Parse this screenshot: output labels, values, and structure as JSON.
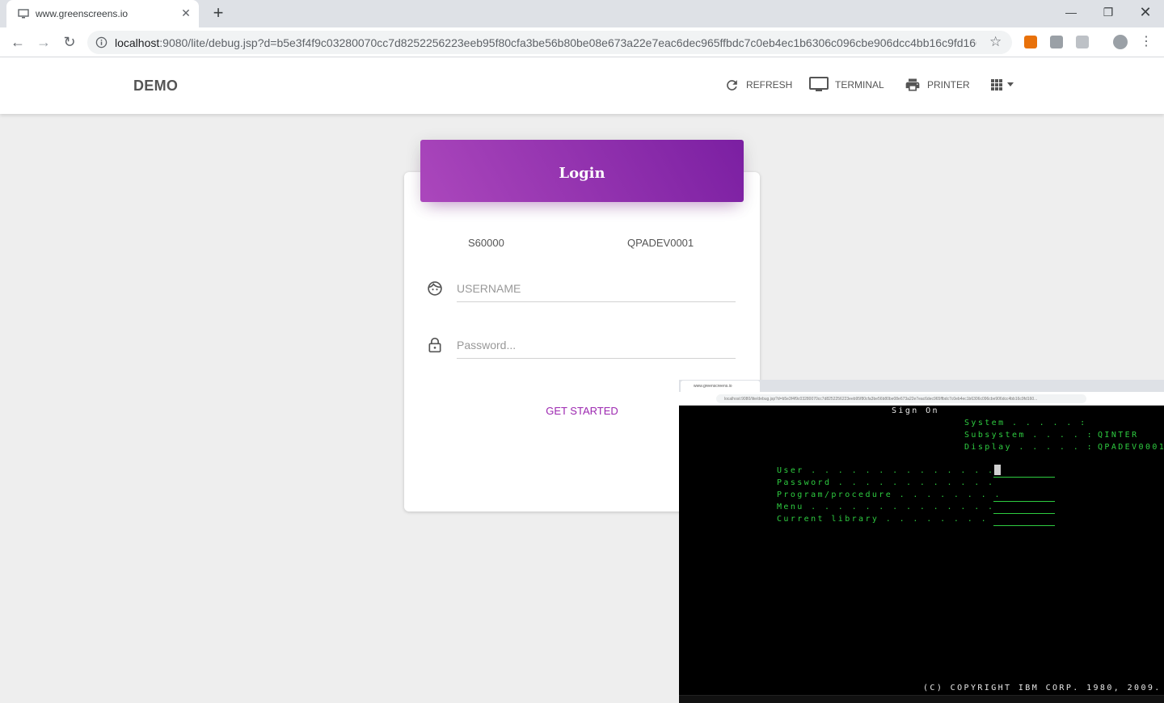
{
  "browser": {
    "tab_title": "www.greenscreens.io",
    "url_host": "localhost",
    "url_rest": ":9080/lite/debug.jsp?d=b5e3f4f9c03280070cc7d8252256223eeb95f80cfa3be56b80be08e673a22e7eac6dec965ffbdc7c0eb4ec1b6306c096cbe906dcc4bb16c9fd160...",
    "new_tab_label": "+"
  },
  "app": {
    "brand": "DEMO",
    "nav": {
      "refresh": "REFRESH",
      "terminal": "TERMINAL",
      "printer": "PRINTER"
    }
  },
  "login": {
    "title": "Login",
    "system_id": "S60000",
    "device_name": "QPADEV0001",
    "username_placeholder": "USERNAME",
    "password_placeholder": "Password...",
    "submit_label": "GET STARTED"
  },
  "terminal_preview": {
    "tab_title": "www.greenscreens.io",
    "url": "localhost:9080/lite/debug.jsp?d=b5e3f4f9c03280070cc7d8252256223eeb95f80cfa3be56b80be08e673a22e7eac6dec965ffbdc7c0eb4ec1b6306c096cbe906dcc4bb16c9fd160...",
    "heading": "Sign On",
    "system_label": "System . . . . . :",
    "system_value": "",
    "subsystem_label": "Subsystem . . . . :",
    "subsystem_value": "QINTER",
    "display_label": "Display . . . . . :",
    "display_value": "QPADEV0001",
    "user_label": "User . . . . . . . . . . . . . .",
    "password_label": "Password . . . . . . . . . . . .",
    "program_label": "Program/procedure . . . . . . . .",
    "menu_label": "Menu . . . . . . . . . . . . . .",
    "library_label": "Current library . . . . . . . .",
    "copyright": "(C) COPYRIGHT IBM CORP. 1980, 2009."
  },
  "colors": {
    "accent": "#9c27b0",
    "header_gradient_start": "#ab47bc",
    "header_gradient_end": "#7b1fa2",
    "terminal_green": "#2ecc40",
    "page_background": "#eeeeee"
  }
}
